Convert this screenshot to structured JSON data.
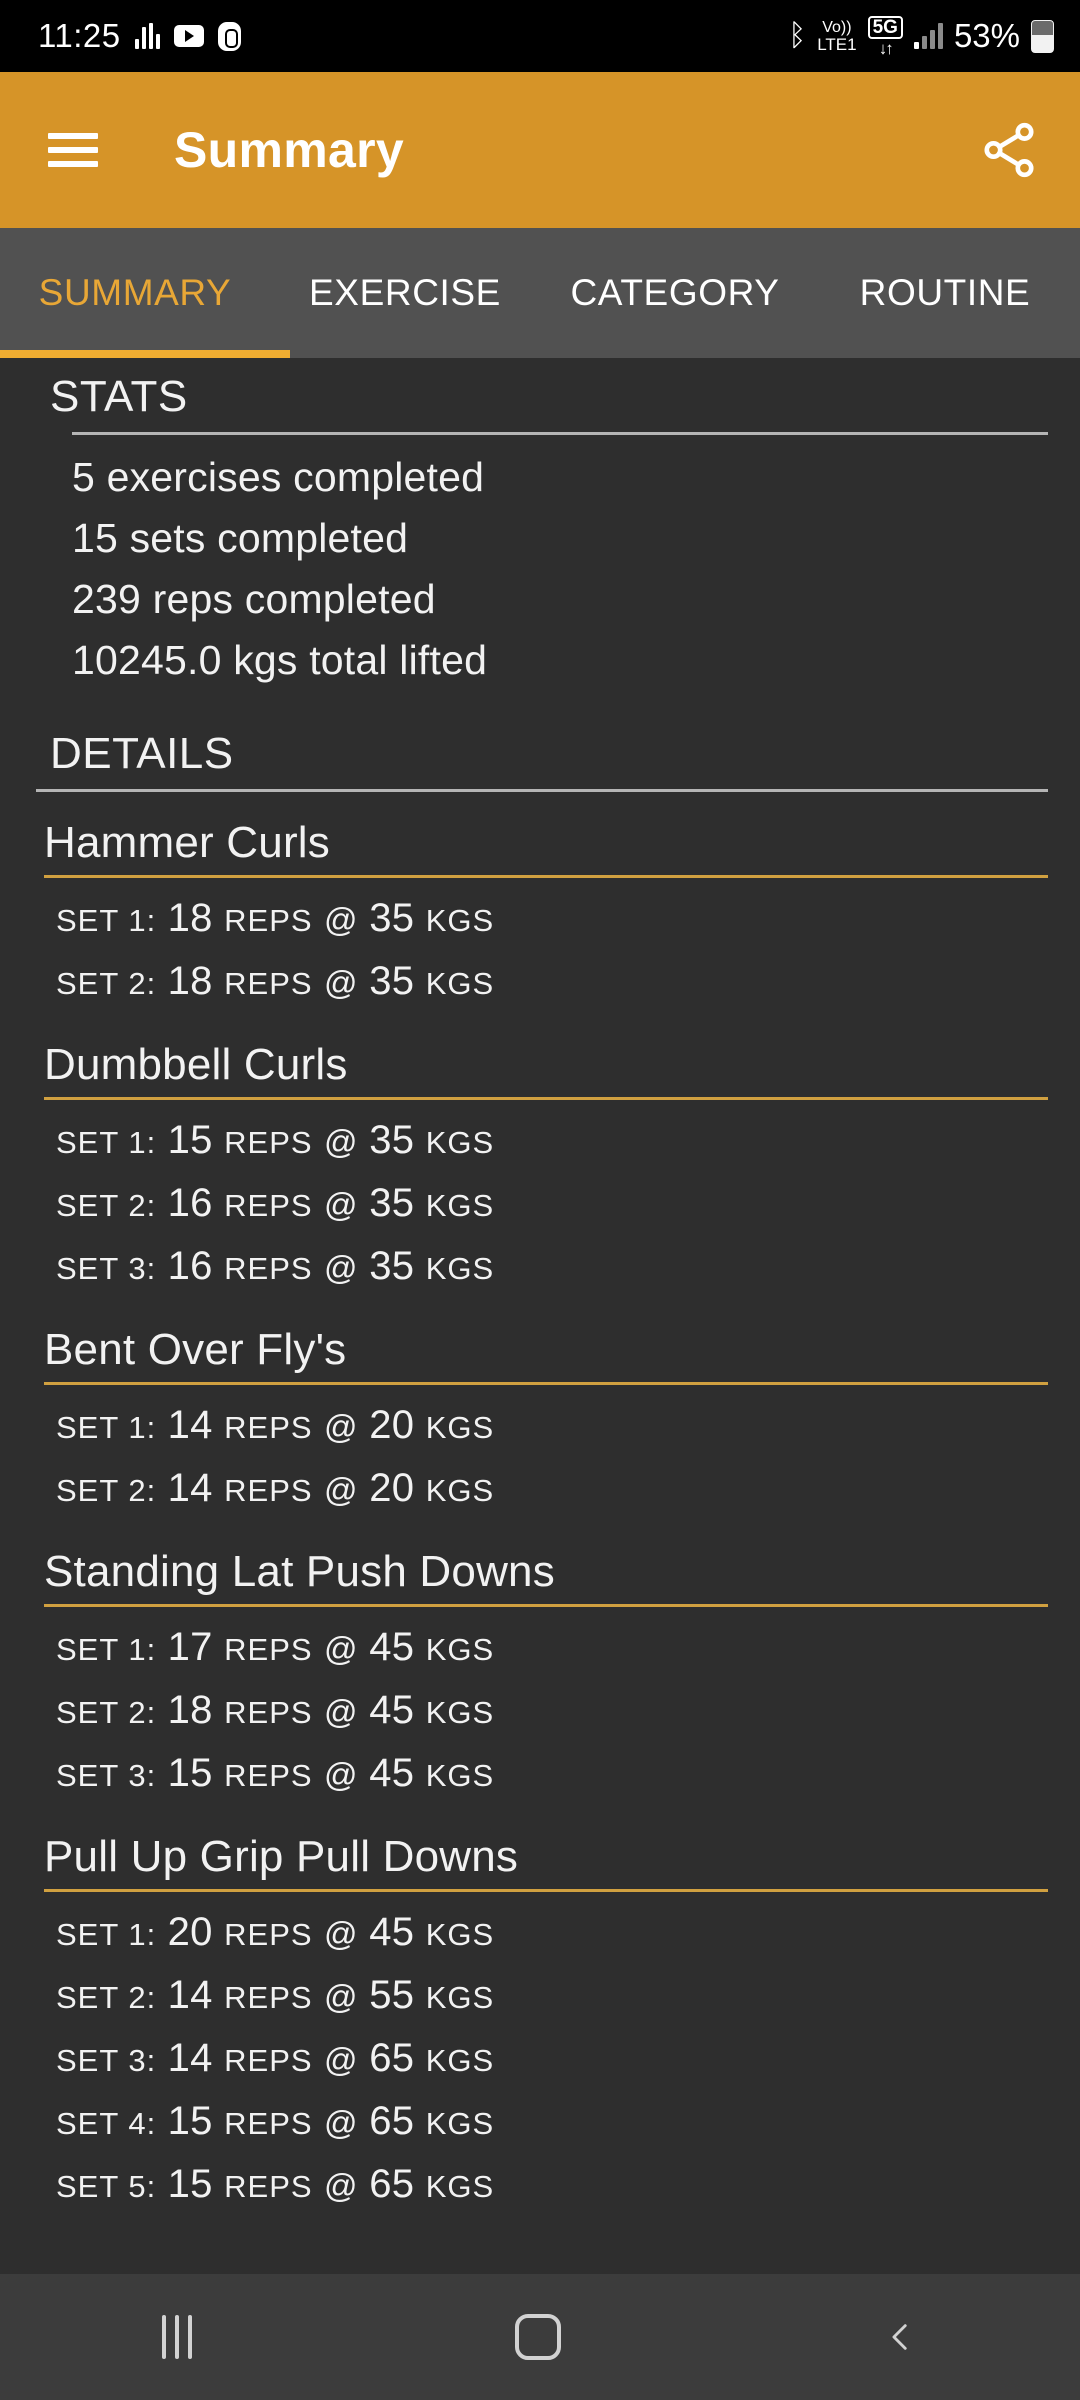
{
  "status_bar": {
    "time": "11:25",
    "left_icons": [
      "equalizer-icon",
      "youtube-icon",
      "fingerprint-icon"
    ],
    "bluetooth_glyph": "ᛒ",
    "volte_line1": "Vo))",
    "volte_line2": "LTE1",
    "network_type": "5G",
    "network_arrows": "↓↑",
    "battery_percent": "53%"
  },
  "app_bar": {
    "title": "Summary",
    "menu_icon": "hamburger-menu-icon",
    "share_icon": "share-icon",
    "background_color": "#d69428"
  },
  "tabs": {
    "items": [
      {
        "label": "SUMMARY",
        "active": true
      },
      {
        "label": "EXERCISE",
        "active": false
      },
      {
        "label": "CATEGORY",
        "active": false
      },
      {
        "label": "ROUTINE",
        "active": false
      }
    ],
    "active_color": "#e8a736",
    "indicator_color": "#f0ad31"
  },
  "stats": {
    "heading": "STATS",
    "lines": [
      "5 exercises completed",
      "15 sets completed",
      "239 reps completed",
      "10245.0 kgs total lifted"
    ]
  },
  "details": {
    "heading": "DETAILS",
    "set_label_prefix": "SET",
    "reps_label": "REPS",
    "at_symbol": "@",
    "weight_unit": "KGS",
    "exercises": [
      {
        "name": "Hammer Curls",
        "sets": [
          {
            "set": "SET 1:",
            "reps": "18",
            "weight": "35"
          },
          {
            "set": "SET 2:",
            "reps": "18",
            "weight": "35"
          }
        ]
      },
      {
        "name": "Dumbbell Curls",
        "sets": [
          {
            "set": "SET 1:",
            "reps": "15",
            "weight": "35"
          },
          {
            "set": "SET 2:",
            "reps": "16",
            "weight": "35"
          },
          {
            "set": "SET 3:",
            "reps": "16",
            "weight": "35"
          }
        ]
      },
      {
        "name": "Bent Over Fly's",
        "sets": [
          {
            "set": "SET 1:",
            "reps": "14",
            "weight": "20"
          },
          {
            "set": "SET 2:",
            "reps": "14",
            "weight": "20"
          }
        ]
      },
      {
        "name": "Standing Lat Push Downs",
        "sets": [
          {
            "set": "SET 1:",
            "reps": "17",
            "weight": "45"
          },
          {
            "set": "SET 2:",
            "reps": "18",
            "weight": "45"
          },
          {
            "set": "SET 3:",
            "reps": "15",
            "weight": "45"
          }
        ]
      },
      {
        "name": "Pull Up Grip Pull Downs",
        "sets": [
          {
            "set": "SET 1:",
            "reps": "20",
            "weight": "45"
          },
          {
            "set": "SET 2:",
            "reps": "14",
            "weight": "55"
          },
          {
            "set": "SET 3:",
            "reps": "14",
            "weight": "65"
          },
          {
            "set": "SET 4:",
            "reps": "15",
            "weight": "65"
          },
          {
            "set": "SET 5:",
            "reps": "15",
            "weight": "65"
          }
        ]
      }
    ]
  },
  "nav_bar": {
    "recents_icon": "recents-icon",
    "home_icon": "home-icon",
    "back_icon": "back-icon"
  }
}
